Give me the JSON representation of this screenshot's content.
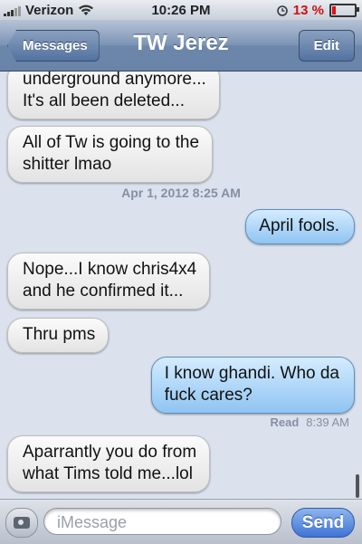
{
  "status_bar": {
    "carrier": "Verizon",
    "time": "10:26 PM",
    "battery_percent": "13 %",
    "wifi_icon": "wifi-icon",
    "alarm_icon": "alarm-icon"
  },
  "nav": {
    "back_label": "Messages",
    "title": "TW Jerez",
    "edit_label": "Edit"
  },
  "thread": {
    "messages": [
      {
        "direction": "in",
        "text_lines": [
          "underground anymore...",
          "It's all been deleted..."
        ]
      },
      {
        "direction": "in",
        "text_lines": [
          "All of Tw is going to the",
          "shitter lmao"
        ]
      },
      {
        "timestamp": "Apr 1, 2012 8:25 AM"
      },
      {
        "direction": "out",
        "text_lines": [
          "April fools."
        ]
      },
      {
        "direction": "in",
        "text_lines": [
          "Nope...I know chris4x4",
          "and he confirmed it..."
        ]
      },
      {
        "direction": "in",
        "text_lines": [
          "Thru pms"
        ]
      },
      {
        "direction": "out",
        "text_lines": [
          "I know ghandi. Who da",
          "fuck cares?"
        ]
      },
      {
        "read_receipt": {
          "label": "Read",
          "time": "8:39 AM"
        }
      },
      {
        "direction": "in",
        "text_lines": [
          "Aparrantly you do from",
          "what Tims told me...lol"
        ]
      }
    ]
  },
  "input_bar": {
    "placeholder": "iMessage",
    "send_label": "Send",
    "camera_icon": "camera-icon"
  },
  "colors": {
    "background": "#dbe2ed",
    "outgoing_bubble": "#8fc4f2",
    "incoming_bubble": "#e3e3e3",
    "send_button": "#3f74d6",
    "battery_low": "#cc1111"
  }
}
